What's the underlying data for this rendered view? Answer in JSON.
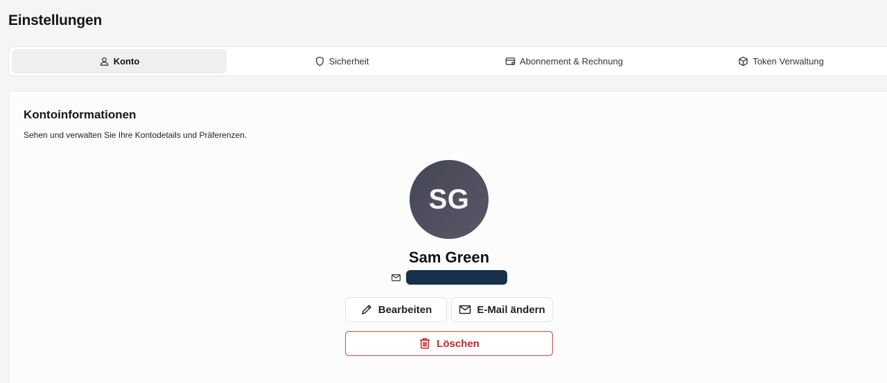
{
  "page": {
    "title": "Einstellungen"
  },
  "tabs": [
    {
      "label": "Konto",
      "icon": "user-icon",
      "active": true
    },
    {
      "label": "Sicherheit",
      "icon": "shield-icon",
      "active": false
    },
    {
      "label": "Abonnement & Rechnung",
      "icon": "credit-card-icon",
      "active": false
    },
    {
      "label": "Token Verwaltung",
      "icon": "box-icon",
      "active": false
    }
  ],
  "account": {
    "title": "Kontoinformationen",
    "description": "Sehen und verwalten Sie Ihre Kontodetails und Präferenzen.",
    "initials": "SG",
    "name": "Sam Green",
    "email_redacted": true
  },
  "actions": {
    "edit_label": "Bearbeiten",
    "change_email_label": "E-Mail ändern",
    "delete_label": "Löschen"
  },
  "colors": {
    "danger": "#c42828",
    "avatar_bg": "#4b4a5c",
    "redaction": "#17314a"
  }
}
